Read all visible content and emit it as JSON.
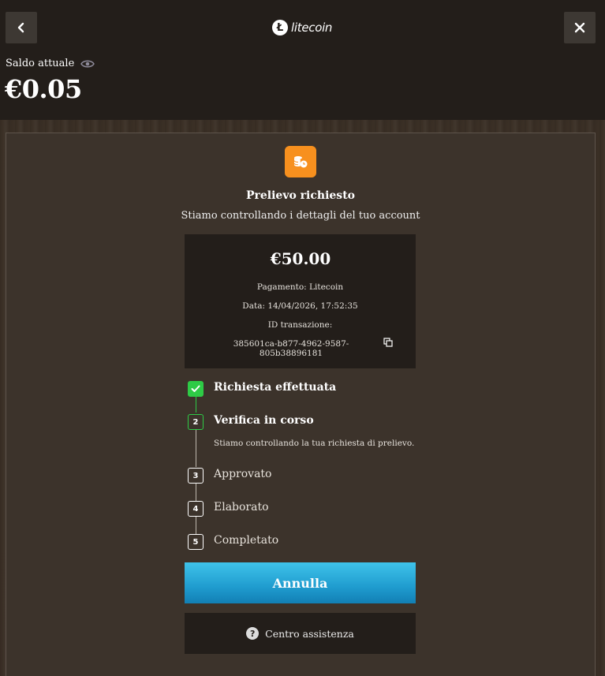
{
  "header": {
    "logo_letter": "Ł",
    "logo_text": "litecoin",
    "balance_label": "Saldo attuale",
    "balance_value": "€0.05"
  },
  "status": {
    "icon": "coins-clock-icon",
    "icon_color": "#f7901e",
    "title": "Prelievo richiesto",
    "subtitle": "Stiamo controllando i dettagli del tuo account"
  },
  "details": {
    "amount": "€50.00",
    "payment": "Pagamento: Litecoin",
    "date": "Data: 14/04/2026, 17:52:35",
    "transaction_label": "ID transazione:",
    "transaction_id": "385601ca-b877-4962-9587-805b38896181"
  },
  "steps": [
    {
      "number": "",
      "label": "Richiesta effettuata",
      "state": "done"
    },
    {
      "number": "2",
      "label": "Verifica in corso",
      "state": "active",
      "description": "Stiamo controllando la tua richiesta di prelievo."
    },
    {
      "number": "3",
      "label": "Approvato",
      "state": "pending"
    },
    {
      "number": "4",
      "label": "Elaborato",
      "state": "pending"
    },
    {
      "number": "5",
      "label": "Completato",
      "state": "pending"
    }
  ],
  "actions": {
    "cancel_label": "Annulla",
    "help_label": "Centro assistenza",
    "help_icon_glyph": "?"
  },
  "colors": {
    "accent_green": "#2ecb46",
    "button_blue": "#1f9ccf"
  }
}
